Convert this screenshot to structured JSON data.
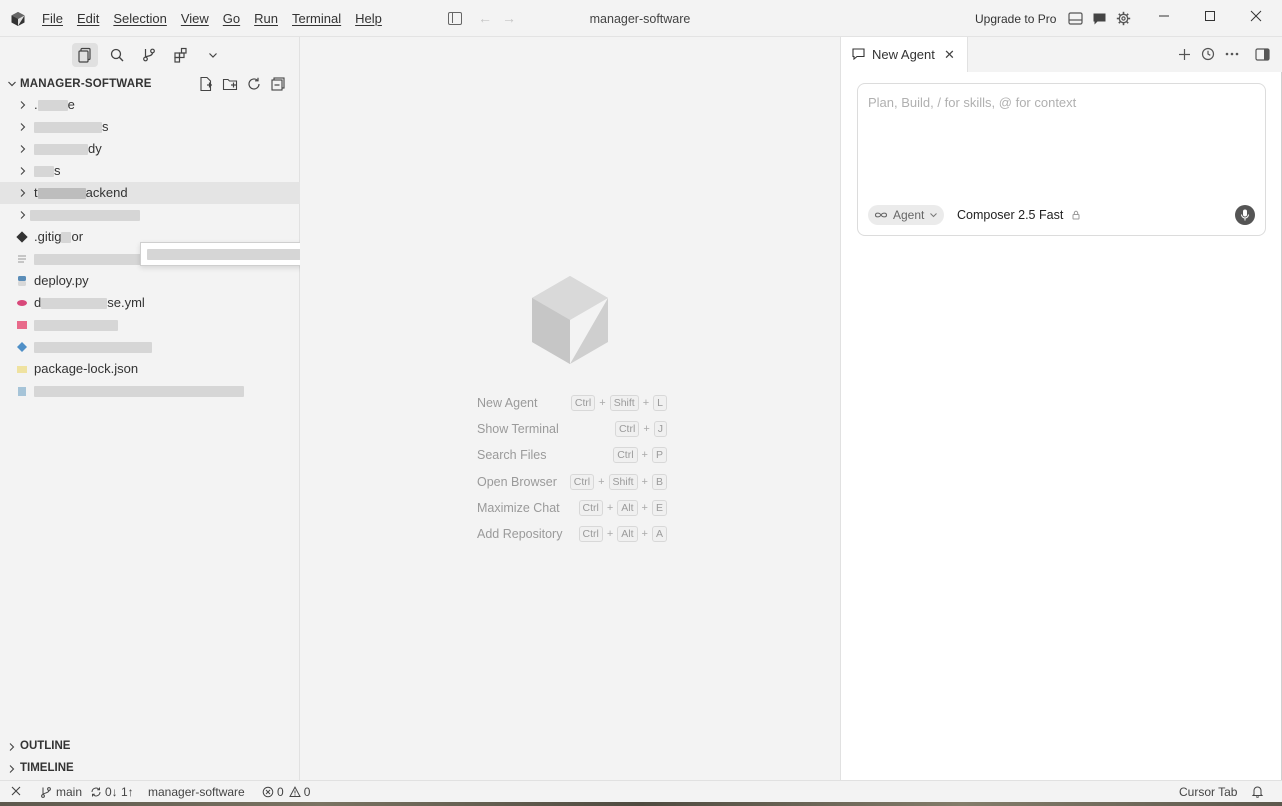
{
  "titlebar": {
    "menu": [
      "File",
      "Edit",
      "Selection",
      "View",
      "Go",
      "Run",
      "Terminal",
      "Help"
    ],
    "title": "manager-software",
    "upgrade_label": "Upgrade to Pro",
    "back_arrow": "←",
    "forward_arrow": "→"
  },
  "sidebar": {
    "tabs": [
      "files-icon",
      "search-icon",
      "source-control-icon",
      "extensions-icon",
      "chevron-down-icon"
    ],
    "explorer_title": "MANAGER-SOFTWARE",
    "tree": [
      {
        "type": "folder",
        "name": ".",
        "suffix": "e"
      },
      {
        "type": "folder",
        "name": "",
        "suffix": "s"
      },
      {
        "type": "folder",
        "name": "",
        "suffix": "dy"
      },
      {
        "type": "folder",
        "name": "",
        "suffix": "s"
      },
      {
        "type": "folder",
        "name": "t",
        "suffix": "ackend"
      },
      {
        "type": "folder",
        "name": "",
        "suffix": ""
      },
      {
        "type": "file",
        "name": ".gitig",
        "suffix": "or"
      },
      {
        "type": "file",
        "name": "",
        "suffix": ""
      },
      {
        "type": "file",
        "name": "deploy.py",
        "suffix": ""
      },
      {
        "type": "file",
        "name": "d",
        "suffix": "se.yml"
      },
      {
        "type": "file",
        "name": "",
        "suffix": ""
      },
      {
        "type": "file",
        "name": "",
        "suffix": ""
      },
      {
        "type": "file",
        "name": "package-lock.json",
        "suffix": ""
      },
      {
        "type": "file",
        "name": "",
        "suffix": ""
      }
    ],
    "sections": [
      "OUTLINE",
      "TIMELINE"
    ]
  },
  "editor": {
    "shortcuts": [
      {
        "label": "New Agent",
        "keys": [
          "Ctrl",
          "Shift",
          "L"
        ]
      },
      {
        "label": "Show Terminal",
        "keys": [
          "Ctrl",
          "J"
        ]
      },
      {
        "label": "Search Files",
        "keys": [
          "Ctrl",
          "P"
        ]
      },
      {
        "label": "Open Browser",
        "keys": [
          "Ctrl",
          "Shift",
          "B"
        ]
      },
      {
        "label": "Maximize Chat",
        "keys": [
          "Ctrl",
          "Alt",
          "E"
        ]
      },
      {
        "label": "Add Repository",
        "keys": [
          "Ctrl",
          "Alt",
          "A"
        ]
      }
    ]
  },
  "agent": {
    "tab_label": "New Agent",
    "close_glyph": "✕",
    "placeholder": "Plan, Build, / for skills, @ for context",
    "mode_label": "Agent",
    "model_label": "Composer 2.5 Fast"
  },
  "statusbar": {
    "branch": "main",
    "sync": "0↓ 1↑",
    "workspace": "manager-software",
    "errors": "0",
    "warnings": "0",
    "right_label": "Cursor Tab"
  },
  "colors": {
    "background": "#f3f3f3",
    "panel": "#ffffff",
    "muted_text": "#9a9a9a"
  }
}
